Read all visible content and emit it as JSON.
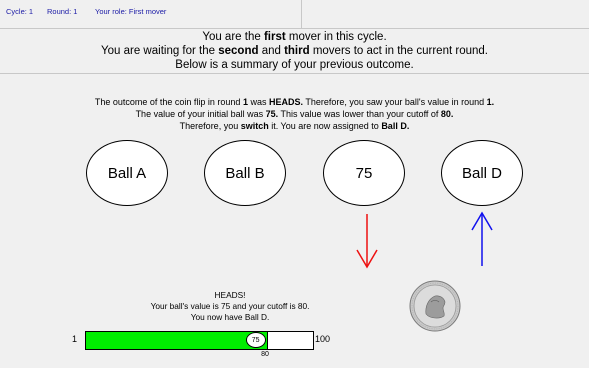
{
  "status_bar": {
    "cycle": "Cycle: 1",
    "round": "Round: 1",
    "role": "Your role: First mover"
  },
  "header": {
    "line1_pre": "You are the ",
    "line1_bold": "first",
    "line1_post": " mover in this cycle.",
    "line2_pre": "You are waiting for the ",
    "line2_bold1": "second",
    "line2_mid": " and ",
    "line2_bold2": "third",
    "line2_post": " movers to act in the current round.",
    "line3": "Below is a summary of your previous outcome."
  },
  "summary": {
    "s1_a": "The outcome of the coin flip in round ",
    "s1_round": "1",
    "s1_b": " was ",
    "s1_result": "HEADS.",
    "s1_c": " Therefore, you saw your ball's value in round ",
    "s1_round2": "1.",
    "s2_a": "The value of your initial ball was ",
    "s2_value": "75.",
    "s2_b": "  This value was lower than your cutoff of ",
    "s2_cutoff": "80.",
    "s3_a": "Therefore, you ",
    "s3_action": "switch",
    "s3_b": " it. You are now assigned to ",
    "s3_ball": "Ball D."
  },
  "balls": [
    {
      "label": "Ball A"
    },
    {
      "label": "Ball B"
    },
    {
      "label": "75"
    },
    {
      "label": "Ball D"
    }
  ],
  "colors": {
    "down_arrow": "#ee1111",
    "up_arrow": "#1111ee",
    "bar_fill": "#00ee00"
  },
  "feedback": {
    "line1": "HEADS!",
    "line2": "Your ball's value is 75 and your cutoff is 80.",
    "line3": "You now have Ball D."
  },
  "bar": {
    "min_label": "1",
    "max_label": "100",
    "value_label": "75",
    "cutoff_label": "80",
    "min": 1,
    "max": 100,
    "value": 75,
    "cutoff": 80
  },
  "icons": {
    "coin": "quarter-coin-icon",
    "down": "arrow-down-icon",
    "up": "arrow-up-icon"
  }
}
